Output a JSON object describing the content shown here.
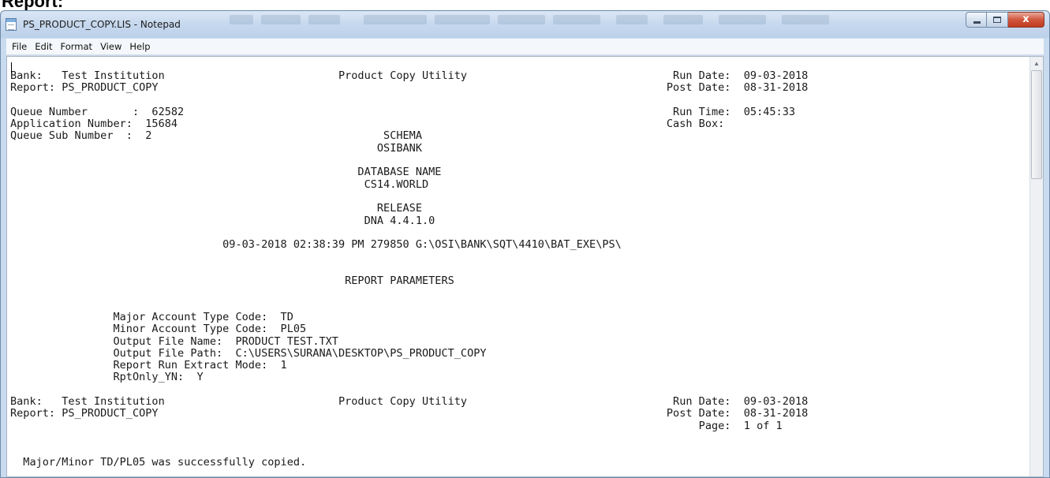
{
  "page_heading": "Report:",
  "window": {
    "title": "PS_PRODUCT_COPY.LIS - Notepad",
    "close_label": "x"
  },
  "menu": [
    "File",
    "Edit",
    "Format",
    "View",
    "Help"
  ],
  "icons": {
    "app": "notepad-icon",
    "minimize": "minimize-icon",
    "maximize": "maximize-icon",
    "close": "close-icon"
  },
  "colors": {
    "titlebar": "#c6d8ee",
    "close_button": "#c8442a",
    "editor_bg": "#ffffff"
  },
  "document": {
    "text": "Bank:   Test Institution                           Product Copy Utility                                Run Date:  09-03-2018\nReport: PS_PRODUCT_COPY                                                                               Post Date:  08-31-2018\n\nQueue Number       :  62582                                                                            Run Time:  05:45:33\nApplication Number:  15684                                                                            Cash Box:\nQueue Sub Number  :  2                                    SCHEMA\n                                                         OSIBANK\n\n                                                      DATABASE NAME\n                                                       CS14.WORLD\n\n                                                         RELEASE\n                                                       DNA 4.4.1.0\n\n                                 09-03-2018 02:38:39 PM 279850 G:\\OSI\\BANK\\SQT\\4410\\BAT_EXE\\PS\\\n\n\n                                                    REPORT PARAMETERS\n\n\n                Major Account Type Code:  TD\n                Minor Account Type Code:  PL05\n                Output File Name:  PRODUCT TEST.TXT\n                Output File Path:  C:\\USERS\\SURANA\\DESKTOP\\PS_PRODUCT_COPY\n                Report Run Extract Mode:  1\n                RptOnly_YN:  Y\n\nBank:   Test Institution                           Product Copy Utility                                Run Date:  09-03-2018\nReport: PS_PRODUCT_COPY                                                                               Post Date:  08-31-2018\n                                                                                                           Page:  1 of 1\n\n\n  Major/Minor TD/PL05 was successfully copied."
  }
}
